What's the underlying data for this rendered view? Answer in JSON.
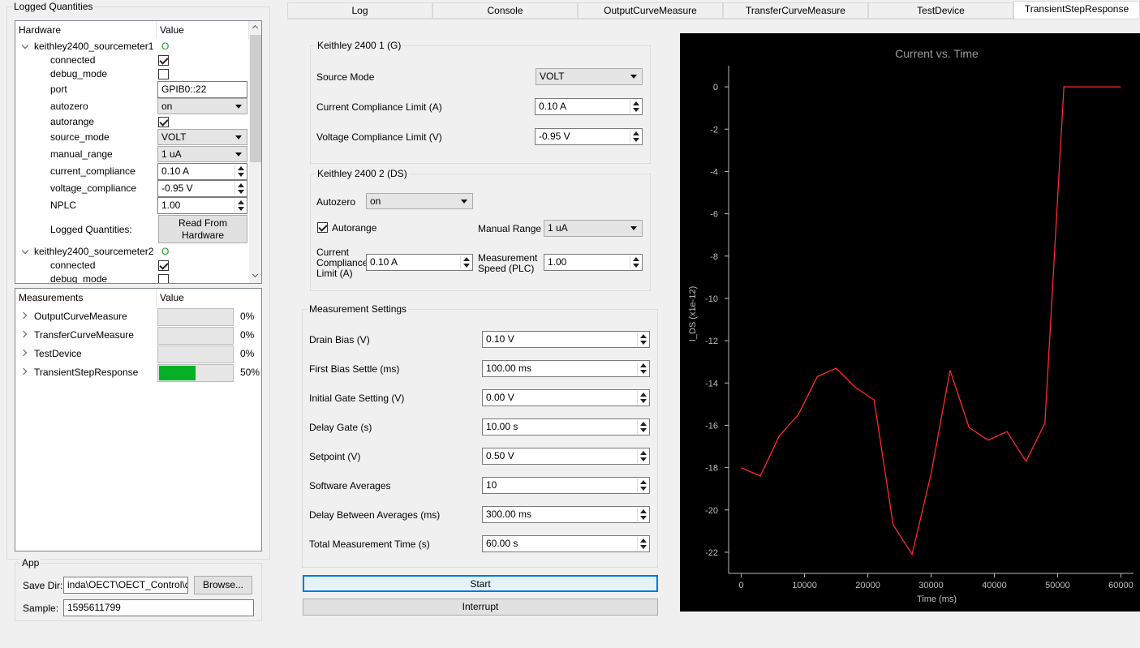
{
  "left": {
    "logged": {
      "title": "Logged Quantities",
      "col_hardware": "Hardware",
      "col_value": "Value",
      "hw1": {
        "name": "keithley2400_sourcemeter1",
        "status": "O",
        "connected": "connected",
        "debug_mode": "debug_mode",
        "port": "port",
        "port_value": "GPIB0::22",
        "autozero": "autozero",
        "autozero_value": "on",
        "autorange": "autorange",
        "source_mode": "source_mode",
        "source_mode_value": "VOLT",
        "manual_range": "manual_range",
        "manual_range_value": "1 uA",
        "current_compliance": "current_compliance",
        "current_compliance_value": "0.10 A",
        "voltage_compliance": "voltage_compliance",
        "voltage_compliance_value": "-0.95 V",
        "nplc": "NPLC",
        "nplc_value": "1.00",
        "logged_quantities": "Logged Quantities:",
        "read_btn_line1": "Read From",
        "read_btn_line2": "Hardware"
      },
      "hw2": {
        "name": "keithley2400_sourcemeter2",
        "status": "O",
        "connected": "connected",
        "debug_mode": "debug_mode"
      }
    },
    "measurements": {
      "col_name": "Measurements",
      "col_value": "Value",
      "items": [
        {
          "name": "OutputCurveMeasure",
          "pct_label": "0%",
          "progress": 0
        },
        {
          "name": "TransferCurveMeasure",
          "pct_label": "0%",
          "progress": 0
        },
        {
          "name": "TestDevice",
          "pct_label": "0%",
          "progress": 0
        },
        {
          "name": "TransientStepResponse",
          "pct_label": "50%",
          "progress": 0.5
        }
      ]
    },
    "app": {
      "title": "App",
      "save_dir_label": "Save Dir:",
      "save_dir_value": "inda\\OECT\\OECT_Control\\data",
      "browse": "Browse...",
      "sample_label": "Sample:",
      "sample_value": "1595611799"
    }
  },
  "tabs": [
    "Log",
    "Console",
    "OutputCurveMeasure",
    "TransferCurveMeasure",
    "TestDevice",
    "TransientStepResponse"
  ],
  "active_tab": "TransientStepResponse",
  "k1": {
    "title": "Keithley 2400 1 (G)",
    "source_mode_label": "Source Mode",
    "source_mode_value": "VOLT",
    "current_limit_label": "Current Compliance Limit (A)",
    "current_limit_value": "0.10 A",
    "voltage_limit_label": "Voltage Compliance Limit (V)",
    "voltage_limit_value": "-0.95 V"
  },
  "k2": {
    "title": "Keithley 2400 2 (DS)",
    "autozero_label": "Autozero",
    "autozero_value": "on",
    "autorange_label": "Autorange",
    "manual_range_label": "Manual Range",
    "manual_range_value": "1 uA",
    "cc_label_1": "Current",
    "cc_label_2": "Compliance",
    "cc_label_3": "Limit (A)",
    "cc_value": "0.10 A",
    "ms_label_1": "Measurement",
    "ms_label_2": "Speed (PLC)",
    "ms_value": "1.00"
  },
  "settings": {
    "title": "Measurement Settings",
    "rows": [
      {
        "label": "Drain Bias (V)",
        "value": "0.10 V"
      },
      {
        "label": "First Bias Settle (ms)",
        "value": "100.00 ms"
      },
      {
        "label": "Initial Gate Setting (V)",
        "value": "0.00 V"
      },
      {
        "label": "Delay Gate (s)",
        "value": "10.00 s"
      },
      {
        "label": "Setpoint (V)",
        "value": "0.50 V"
      },
      {
        "label": "Software Averages",
        "value": "10"
      },
      {
        "label": "Delay Between Averages (ms)",
        "value": "300.00 ms"
      },
      {
        "label": "Total Measurement Time (s)",
        "value": "60.00 s"
      }
    ],
    "start": "Start",
    "interrupt": "Interrupt"
  },
  "chart_data": {
    "type": "line",
    "title": "Current vs. Time",
    "xlabel": "Time (ms)",
    "ylabel": "I_DS (x1e-12)",
    "xlim": [
      -2000,
      62000
    ],
    "ylim": [
      -23,
      1
    ],
    "xticks": [
      0,
      10000,
      20000,
      30000,
      40000,
      50000,
      60000
    ],
    "yticks": [
      0,
      -2,
      -4,
      -6,
      -8,
      -10,
      -12,
      -14,
      -16,
      -18,
      -20,
      -22
    ],
    "grid": false,
    "background": "#000000",
    "line_color": "#ff2a2a",
    "series": [
      {
        "x": [
          0,
          3000,
          6000,
          9000,
          12000,
          15000,
          18000,
          21000,
          24000,
          27000,
          30000,
          33000,
          36000,
          39000,
          42000,
          45000,
          48000,
          51000,
          54000,
          57000,
          60000
        ],
        "y": [
          -18.0,
          -18.4,
          -16.5,
          -15.5,
          -13.7,
          -13.3,
          -14.2,
          -14.8,
          -20.7,
          -22.1,
          -18.3,
          -13.4,
          -16.1,
          -16.7,
          -16.3,
          -17.7,
          -15.9,
          0,
          0,
          0,
          0
        ]
      }
    ]
  }
}
